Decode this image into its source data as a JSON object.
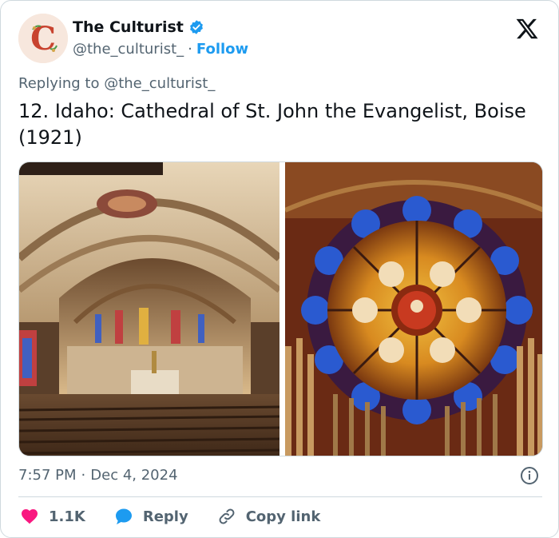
{
  "author": {
    "display_name": "The Culturist",
    "handle": "@the_culturist_",
    "separator": "·",
    "follow_label": "Follow",
    "avatar_letter": "C",
    "verified_color": "#1d9bf0"
  },
  "reply_context": {
    "prefix": "Replying to",
    "mention": "@the_culturist_"
  },
  "tweet": {
    "text": "12. Idaho: Cathedral of St. John the Evangelist, Boise (1921)"
  },
  "media": {
    "images": [
      "cathedral-interior-nave",
      "rose-window-stained-glass"
    ]
  },
  "meta": {
    "time": "7:57 PM",
    "separator": "·",
    "date": "Dec 4, 2024"
  },
  "actions": {
    "like_count": "1.1K",
    "reply_label": "Reply",
    "copy_link_label": "Copy link"
  },
  "icons": {
    "close": "x-logo-icon",
    "info": "info-icon",
    "like": "heart-icon",
    "reply": "speech-bubble-icon",
    "link": "link-icon"
  },
  "colors": {
    "like": "#f91880",
    "link_blue": "#1d9bf0",
    "secondary_text": "#536471"
  }
}
